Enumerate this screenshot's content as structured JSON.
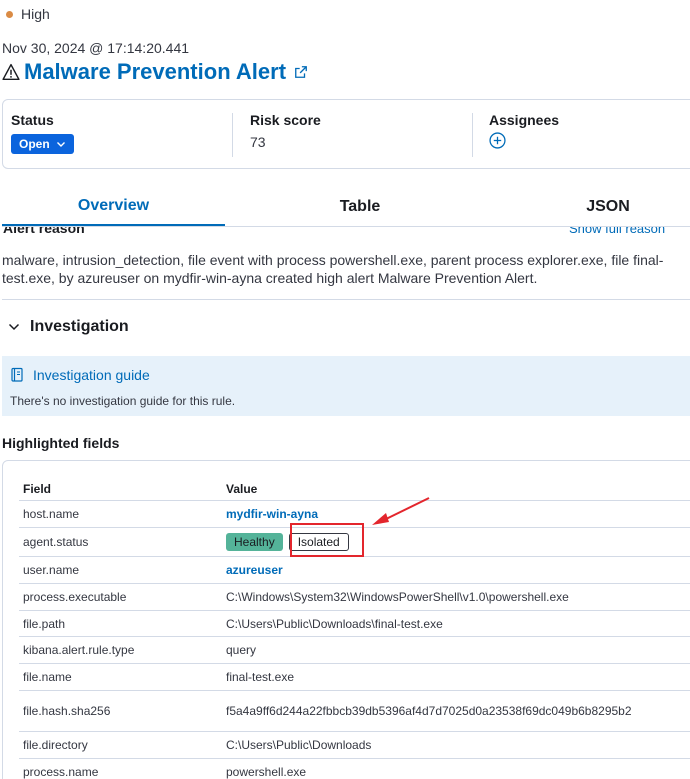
{
  "severity": {
    "label": "High",
    "color": "#da8b45"
  },
  "alert": {
    "timestamp": "Nov 30, 2024 @ 17:14:20.441",
    "title": "Malware Prevention Alert",
    "title_icon": "warning-icon",
    "link_icon": "external-link-icon"
  },
  "summary": {
    "status_label": "Status",
    "status_value": "Open",
    "risk_label": "Risk score",
    "risk_value": "73",
    "assignees_label": "Assignees",
    "add_icon": "add-circle-icon"
  },
  "tabs": [
    {
      "label": "Overview",
      "active": true
    },
    {
      "label": "Table",
      "active": false
    },
    {
      "label": "JSON",
      "active": false
    }
  ],
  "reason": {
    "heading": "Alert reason",
    "link": "Show full reason",
    "text": "malware, intrusion_detection, file event with process powershell.exe, parent process explorer.exe, file final-test.exe, by azureuser on mydfir-win-ayna created high alert Malware Prevention Alert."
  },
  "investigation": {
    "title": "Investigation",
    "guide_link": "Investigation guide",
    "guide_text": "There's no investigation guide for this rule."
  },
  "highlighted": {
    "heading": "Highlighted fields",
    "columns": {
      "field": "Field",
      "value": "Value"
    },
    "rows": [
      {
        "field": "host.name",
        "value": "mydfir-win-ayna"
      },
      {
        "field": "agent.status",
        "value_healthy": "Healthy",
        "value_isolated": "Isolated"
      },
      {
        "field": "user.name",
        "value": "azureuser"
      },
      {
        "field": "process.executable",
        "value": "C:\\Windows\\System32\\WindowsPowerShell\\v1.0\\powershell.exe"
      },
      {
        "field": "file.path",
        "value": "C:\\Users\\Public\\Downloads\\final-test.exe"
      },
      {
        "field": "kibana.alert.rule.type",
        "value": "query"
      },
      {
        "field": "file.name",
        "value": "final-test.exe"
      },
      {
        "field": "file.hash.sha256",
        "value": "f5a4a9ff6d244a22fbbcb39db5396af4d7d7025d0a23538f69dc049b6b8295b2"
      },
      {
        "field": "file.directory",
        "value": "C:\\Users\\Public\\Downloads"
      },
      {
        "field": "process.name",
        "value": "powershell.exe"
      }
    ]
  },
  "annotation": {
    "color": "#e3262d"
  }
}
